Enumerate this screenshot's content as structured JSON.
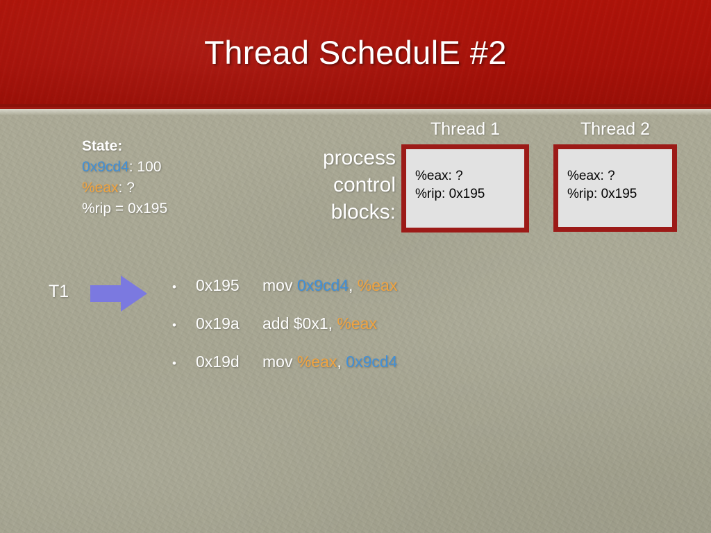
{
  "title": "Thread SchedulE #2",
  "colors": {
    "banner_red": "#ad1108",
    "box_border_red": "#9c1a17",
    "box_fill": "#e2e2e2",
    "background": "#a9a894",
    "memory_blue": "#4190d8",
    "register_orange": "#f0a33f",
    "arrow_purple": "#7b79e0",
    "text_white": "#ffffff"
  },
  "state": {
    "heading": "State:",
    "memory_addr": "0x9cd4",
    "memory_sep": ": ",
    "memory_value": "100",
    "register_name": "%eax",
    "register_sep": ": ",
    "register_value": "?",
    "rip_line": "%rip = 0x195"
  },
  "pcb_label": {
    "line1": "process",
    "line2": "control",
    "line3": "blocks:"
  },
  "threads": [
    {
      "header": "Thread 1",
      "eax": "%eax: ?",
      "rip": "%rip: 0x195"
    },
    {
      "header": "Thread 2",
      "eax": "%eax: ?",
      "rip": "%rip: 0x195"
    }
  ],
  "current_thread": {
    "label": "T1",
    "arrow_icon": "right-arrow-icon"
  },
  "instructions": [
    {
      "bullet": "•",
      "address": "0x195",
      "mnemonic": "mov ",
      "operand1": "0x9cd4",
      "operand1_color": "blue",
      "separator": ", ",
      "operand2": "%eax",
      "operand2_color": "orange"
    },
    {
      "bullet": "•",
      "address": "0x19a",
      "mnemonic": "add ",
      "operand1": "$0x1",
      "operand1_color": "white",
      "separator": ", ",
      "operand2": "%eax",
      "operand2_color": "orange"
    },
    {
      "bullet": "•",
      "address": "0x19d",
      "mnemonic": "mov ",
      "operand1": "%eax",
      "operand1_color": "orange",
      "separator": ", ",
      "operand2": "0x9cd4",
      "operand2_color": "blue"
    }
  ]
}
